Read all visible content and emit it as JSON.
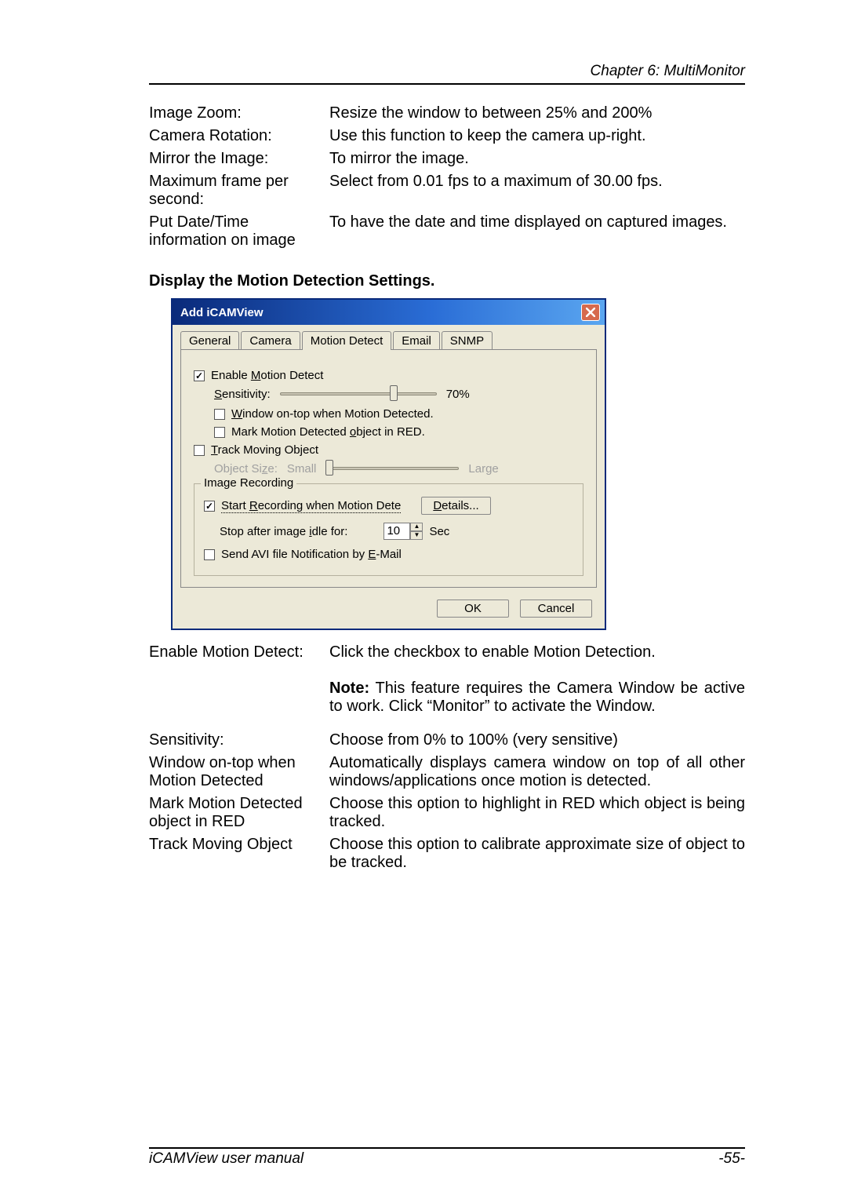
{
  "header": {
    "chapter": "Chapter 6: MultiMonitor"
  },
  "top_defs": [
    {
      "term": "Image Zoom:",
      "desc": "Resize the window to between 25% and 200%"
    },
    {
      "term": "Camera Rotation:",
      "desc": "Use this function to keep the camera up-right."
    },
    {
      "term": "Mirror the Image:",
      "desc": "To mirror the image."
    },
    {
      "term": "Maximum frame per second:",
      "desc": "Select from 0.01 fps to a maximum of 30.00 fps."
    },
    {
      "term": "Put Date/Time information on image",
      "desc": "To have the date and time displayed on captured images."
    }
  ],
  "section_heading": "Display the Motion Detection Settings",
  "dialog": {
    "title": "Add iCAMView",
    "tabs": [
      "General",
      "Camera",
      "Motion Detect",
      "Email",
      "SNMP"
    ],
    "active_tab_index": 2,
    "enable_motion_label_pre": "Enable ",
    "enable_motion_label_u": "M",
    "enable_motion_label_post": "otion Detect",
    "sensitivity_label_u": "S",
    "sensitivity_label_post": "ensitivity:",
    "sensitivity_value": "70%",
    "window_on_top_pre": "",
    "window_on_top_u": "W",
    "window_on_top_post": "indow on-top when Motion Detected.",
    "mark_red_pre": "Mark Motion Detected ",
    "mark_red_u": "o",
    "mark_red_post": "bject in RED.",
    "track_moving_u": "T",
    "track_moving_post": "rack Moving Object",
    "object_size_label_pre": "Object Si",
    "object_size_label_u": "z",
    "object_size_label_post": "e:",
    "object_size_small": "Small",
    "object_size_large": "Large",
    "group_legend": "Image Recording",
    "start_rec_pre": "Start ",
    "start_rec_u": "R",
    "start_rec_post": "ecording when Motion Dete",
    "details_btn_u": "D",
    "details_btn_post": "etails...",
    "stop_after_pre": "Stop after image ",
    "stop_after_u": "i",
    "stop_after_post": "dle for:",
    "stop_after_value": "10",
    "stop_after_unit": "Sec",
    "send_avi_pre": "Send AVI file Notification by ",
    "send_avi_u": "E",
    "send_avi_post": "-Mail",
    "ok": "OK",
    "cancel": "Cancel"
  },
  "bottom_defs": [
    {
      "term": "Enable Motion Detect:",
      "desc": "Click the checkbox to enable Motion Detection.",
      "note_prefix": "Note:",
      "note": " This feature requires the Camera Window be active to work. Click “Monitor” to activate the Window."
    },
    {
      "term": "Sensitivity:",
      "desc": "Choose from 0% to 100% (very sensitive)"
    },
    {
      "term": "Window on-top when Motion Detected",
      "desc": "Automatically displays camera window on top of all other windows/applications once motion is detected."
    },
    {
      "term": "Mark Motion Detected object in RED",
      "desc": "Choose this option to highlight in RED which object is being tracked."
    },
    {
      "term": "Track Moving Object",
      "desc": "Choose this option to calibrate approximate size of object to be tracked."
    }
  ],
  "footer": {
    "left": "iCAMView  user  manual",
    "right": "-55-"
  }
}
